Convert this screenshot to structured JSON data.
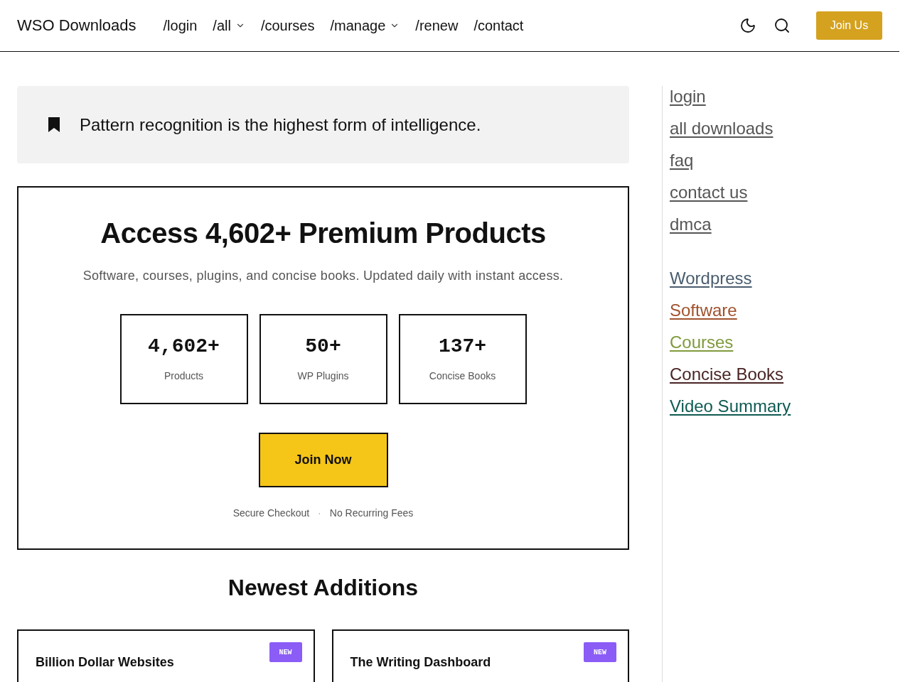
{
  "header": {
    "brand": "WSO Downloads",
    "nav": [
      {
        "label": "/login",
        "dropdown": false
      },
      {
        "label": "/all",
        "dropdown": true
      },
      {
        "label": "/courses",
        "dropdown": false
      },
      {
        "label": "/manage",
        "dropdown": true
      },
      {
        "label": "/renew",
        "dropdown": false
      },
      {
        "label": "/contact",
        "dropdown": false
      }
    ],
    "join_button": "Join Us"
  },
  "quote": {
    "text": "Pattern recognition is the highest form of intelligence."
  },
  "hero": {
    "title": "Access 4,602+ Premium Products",
    "subtitle": "Software, courses, plugins, and concise books. Updated daily with instant access.",
    "stats": [
      {
        "value": "4,602+",
        "label": "Products"
      },
      {
        "value": "50+",
        "label": "WP Plugins"
      },
      {
        "value": "137+",
        "label": "Concise Books"
      }
    ],
    "cta": "Join Now",
    "notes": [
      "Secure Checkout",
      "No Recurring Fees"
    ],
    "separator": "·"
  },
  "newest": {
    "title": "Newest Additions",
    "items": [
      {
        "title": "Billion Dollar Websites",
        "badge": "NEW"
      },
      {
        "title": "The Writing Dashboard",
        "badge": "NEW"
      }
    ]
  },
  "sidebar": {
    "links": [
      "login",
      "all downloads",
      "faq",
      "contact us",
      "dmca"
    ],
    "categories": [
      {
        "label": "Wordpress",
        "color": "#4a5d6e"
      },
      {
        "label": "Software",
        "color": "#a0522d"
      },
      {
        "label": "Courses",
        "color": "#7f9a3c"
      },
      {
        "label": "Concise Books",
        "color": "#4a2424"
      },
      {
        "label": "Video Summary",
        "color": "#0f5a52"
      }
    ]
  }
}
